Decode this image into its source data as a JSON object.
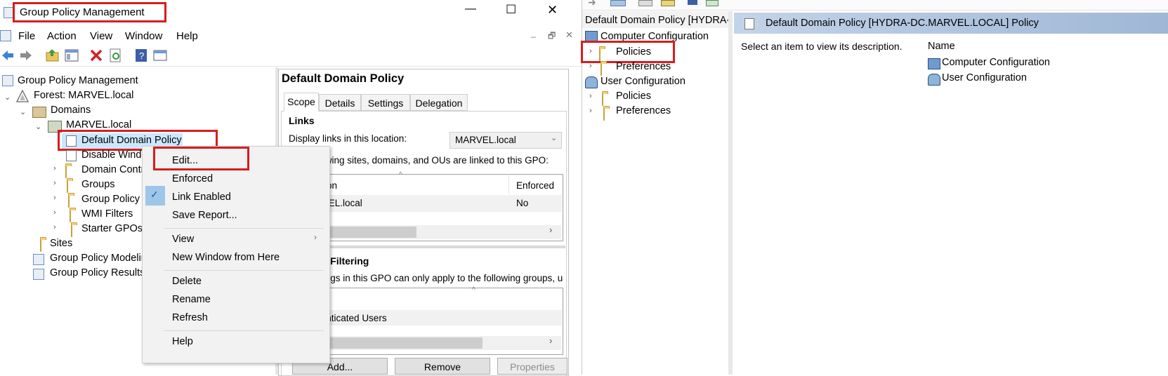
{
  "left_window": {
    "title": "Group Policy Management",
    "title_controls": {
      "minimize": "—",
      "maximize": "☐",
      "close": "✕"
    },
    "menu": [
      "File",
      "Action",
      "View",
      "Window",
      "Help"
    ],
    "tree": {
      "root": "Group Policy Management",
      "forest": "Forest: MARVEL.local",
      "domains": "Domains",
      "domain": "MARVEL.local",
      "items": [
        "Default Domain Policy",
        "Disable Windows Defender",
        "Domain Controllers",
        "Groups",
        "Group Policy Objects",
        "WMI Filters",
        "Starter GPOs"
      ],
      "sites": "Sites",
      "modeling": "Group Policy Modeling",
      "results": "Group Policy Results"
    },
    "detail": {
      "title": "Default Domain Policy",
      "tabs": [
        "Scope",
        "Details",
        "Settings",
        "Delegation"
      ],
      "links_heading": "Links",
      "display_links_label": "Display links in this location:",
      "location_value": "MARVEL.local",
      "linked_text": "The following sites, domains, and OUs are linked to this GPO:",
      "table_headers": [
        "Location",
        "Enforced"
      ],
      "table_row": [
        "MARVEL.local",
        "No"
      ],
      "filtering_heading": "Security Filtering",
      "filtering_text": "The settings in this GPO can only apply to the following groups, users",
      "filtering_row": "Authenticated Users",
      "buttons": [
        "Add...",
        "Remove",
        "Properties"
      ]
    },
    "context_menu": {
      "items": [
        "Edit...",
        "Enforced",
        "Link Enabled",
        "Save Report...",
        "View",
        "New Window from Here",
        "Delete",
        "Rename",
        "Refresh",
        "Help"
      ],
      "checked": "Link Enabled"
    }
  },
  "right_window": {
    "tree_header": "Default Domain Policy [HYDRA-DC.MARVEL.LOCAL] Policy",
    "tree": [
      "Computer Configuration",
      "Policies",
      "Preferences",
      "User Configuration",
      "Policies",
      "Preferences"
    ],
    "content_title": "Default Domain Policy [HYDRA-DC.MARVEL.LOCAL] Policy",
    "description": "Select an item to view its description.",
    "name_header": "Name",
    "items": [
      "Computer Configuration",
      "User Configuration"
    ]
  },
  "colors": {
    "highlight": "#d91c1c",
    "selection": "#cce8ff",
    "header_band": "#a8c0dc"
  }
}
